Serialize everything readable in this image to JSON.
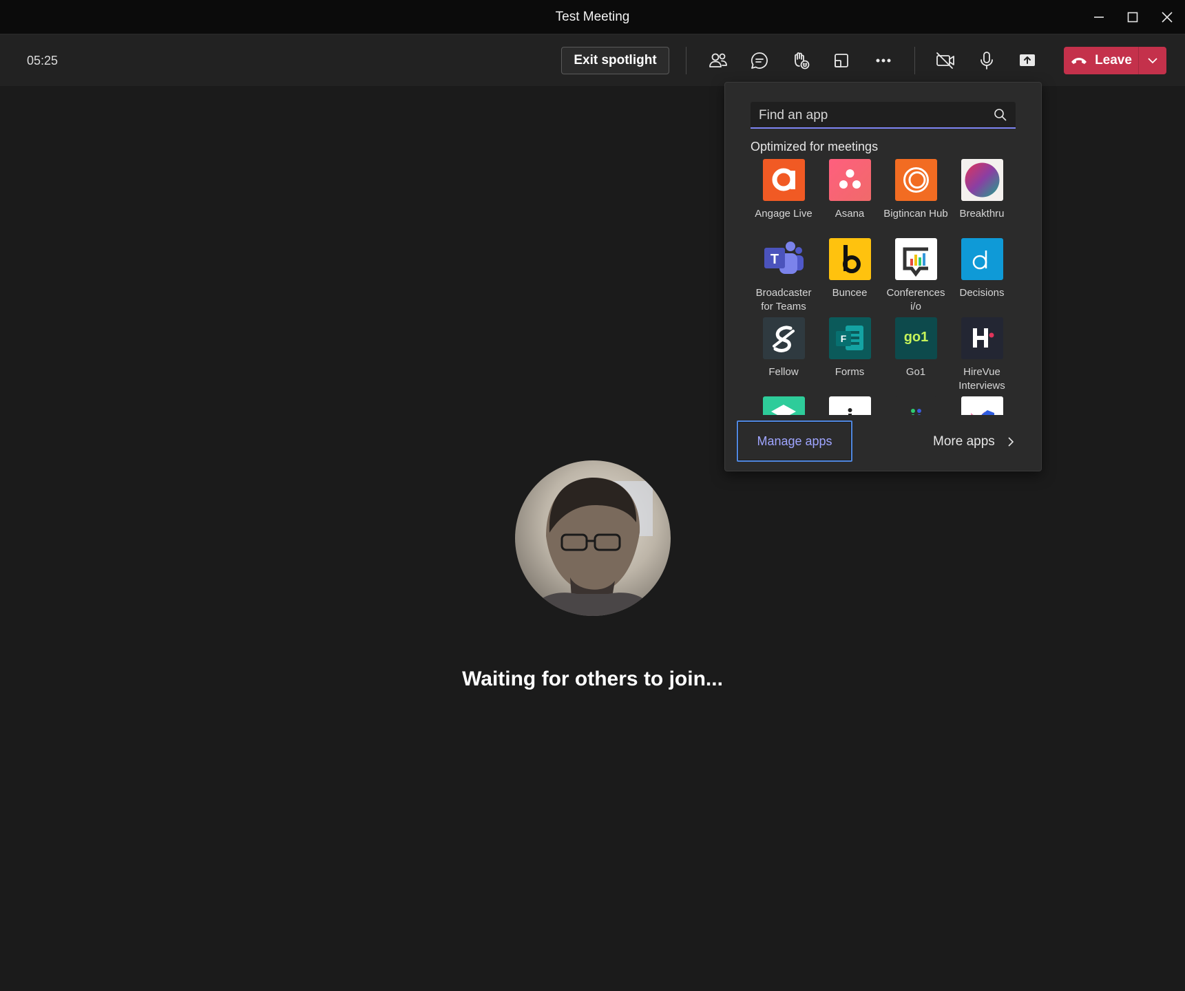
{
  "window": {
    "title": "Test Meeting"
  },
  "toolbar": {
    "timer": "05:25",
    "exit_spotlight_label": "Exit spotlight",
    "leave_label": "Leave",
    "colors": {
      "leave_bg": "#c4314b",
      "accent": "#7f85f5"
    }
  },
  "stage": {
    "waiting_text": "Waiting for others to join..."
  },
  "apps_flyout": {
    "search_placeholder": "Find an app",
    "section_title": "Optimized for meetings",
    "apps": [
      {
        "name": "Angage Live",
        "icon": "angage-live-icon",
        "color": "#f15a24"
      },
      {
        "name": "Asana",
        "icon": "asana-icon",
        "color": "#f06a6a"
      },
      {
        "name": "Bigtincan Hub",
        "icon": "bigtincan-hub-icon",
        "color": "#f26c22"
      },
      {
        "name": "Breakthru",
        "icon": "breakthru-icon",
        "color": "#ffffff"
      },
      {
        "name": "Broadcaster for Teams",
        "icon": "teams-icon",
        "color": "#5b5fc7"
      },
      {
        "name": "Buncee",
        "icon": "buncee-icon",
        "color": "#ffc20e"
      },
      {
        "name": "Conferences i/o",
        "icon": "conferences-io-icon",
        "color": "#ffffff"
      },
      {
        "name": "Decisions",
        "icon": "decisions-icon",
        "color": "#0f9ad7"
      },
      {
        "name": "Fellow",
        "icon": "fellow-icon",
        "color": "#2f3a40"
      },
      {
        "name": "Forms",
        "icon": "forms-icon",
        "color": "#0b5a5a"
      },
      {
        "name": "Go1",
        "icon": "go1-icon",
        "color": "#0d4a4c"
      },
      {
        "name": "HireVue Interviews",
        "icon": "hirevue-icon",
        "color": "#232633"
      },
      {
        "name": "",
        "icon": "stack-icon",
        "color": "#2ecc9a"
      },
      {
        "name": "",
        "icon": "info-app-icon",
        "color": "#ffffff"
      },
      {
        "name": "",
        "icon": "people-app-icon",
        "color": "#2b2b2b"
      },
      {
        "name": "",
        "icon": "chart-app-icon",
        "color": "#ffffff"
      }
    ],
    "manage_apps_label": "Manage apps",
    "more_apps_label": "More apps"
  }
}
